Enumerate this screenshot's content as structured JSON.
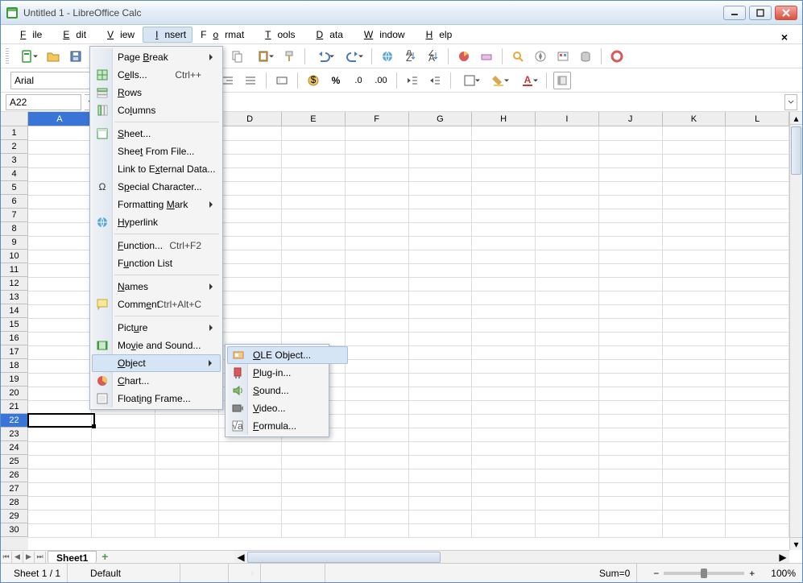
{
  "window": {
    "title": "Untitled 1 - LibreOffice Calc"
  },
  "menubar": {
    "items": [
      "File",
      "Edit",
      "View",
      "Insert",
      "Format",
      "Tools",
      "Data",
      "Window",
      "Help"
    ],
    "active_index": 3
  },
  "namebox": {
    "value": "A22"
  },
  "font": {
    "name": "Arial"
  },
  "columns": [
    "A",
    "B",
    "C",
    "D",
    "E",
    "F",
    "G",
    "H",
    "I",
    "J",
    "K",
    "L"
  ],
  "row_count": 30,
  "selected": {
    "col_index": 0,
    "row": 22
  },
  "sheet_tab": "Sheet1",
  "statusbar": {
    "sheet": "Sheet 1 / 1",
    "style": "Default",
    "sum": "Sum=0",
    "zoom": "100%"
  },
  "insert_menu": [
    {
      "label": "Page Break",
      "sub": true
    },
    {
      "label": "Cells...",
      "shortcut": "Ctrl++",
      "icon": "cells"
    },
    {
      "label": "Rows",
      "icon": "rows"
    },
    {
      "label": "Columns",
      "icon": "cols"
    },
    {
      "sep": true
    },
    {
      "label": "Sheet...",
      "icon": "sheet"
    },
    {
      "label": "Sheet From File..."
    },
    {
      "label": "Link to External Data..."
    },
    {
      "label": "Special Character...",
      "icon": "char"
    },
    {
      "label": "Formatting Mark",
      "sub": true
    },
    {
      "label": "Hyperlink",
      "icon": "link"
    },
    {
      "sep": true
    },
    {
      "label": "Function...",
      "shortcut": "Ctrl+F2"
    },
    {
      "label": "Function List"
    },
    {
      "sep": true
    },
    {
      "label": "Names",
      "sub": true
    },
    {
      "label": "Comment",
      "shortcut": "Ctrl+Alt+C",
      "icon": "comment"
    },
    {
      "sep": true
    },
    {
      "label": "Picture",
      "sub": true
    },
    {
      "label": "Movie and Sound...",
      "icon": "movie"
    },
    {
      "label": "Object",
      "sub": true,
      "highlight": true
    },
    {
      "label": "Chart...",
      "icon": "chart"
    },
    {
      "label": "Floating Frame...",
      "icon": "frame"
    }
  ],
  "object_submenu": [
    {
      "label": "OLE Object...",
      "icon": "ole",
      "highlight": true
    },
    {
      "label": "Plug-in...",
      "icon": "plug"
    },
    {
      "label": "Sound...",
      "icon": "sound"
    },
    {
      "label": "Video...",
      "icon": "video"
    },
    {
      "label": "Formula...",
      "icon": "formula"
    }
  ]
}
